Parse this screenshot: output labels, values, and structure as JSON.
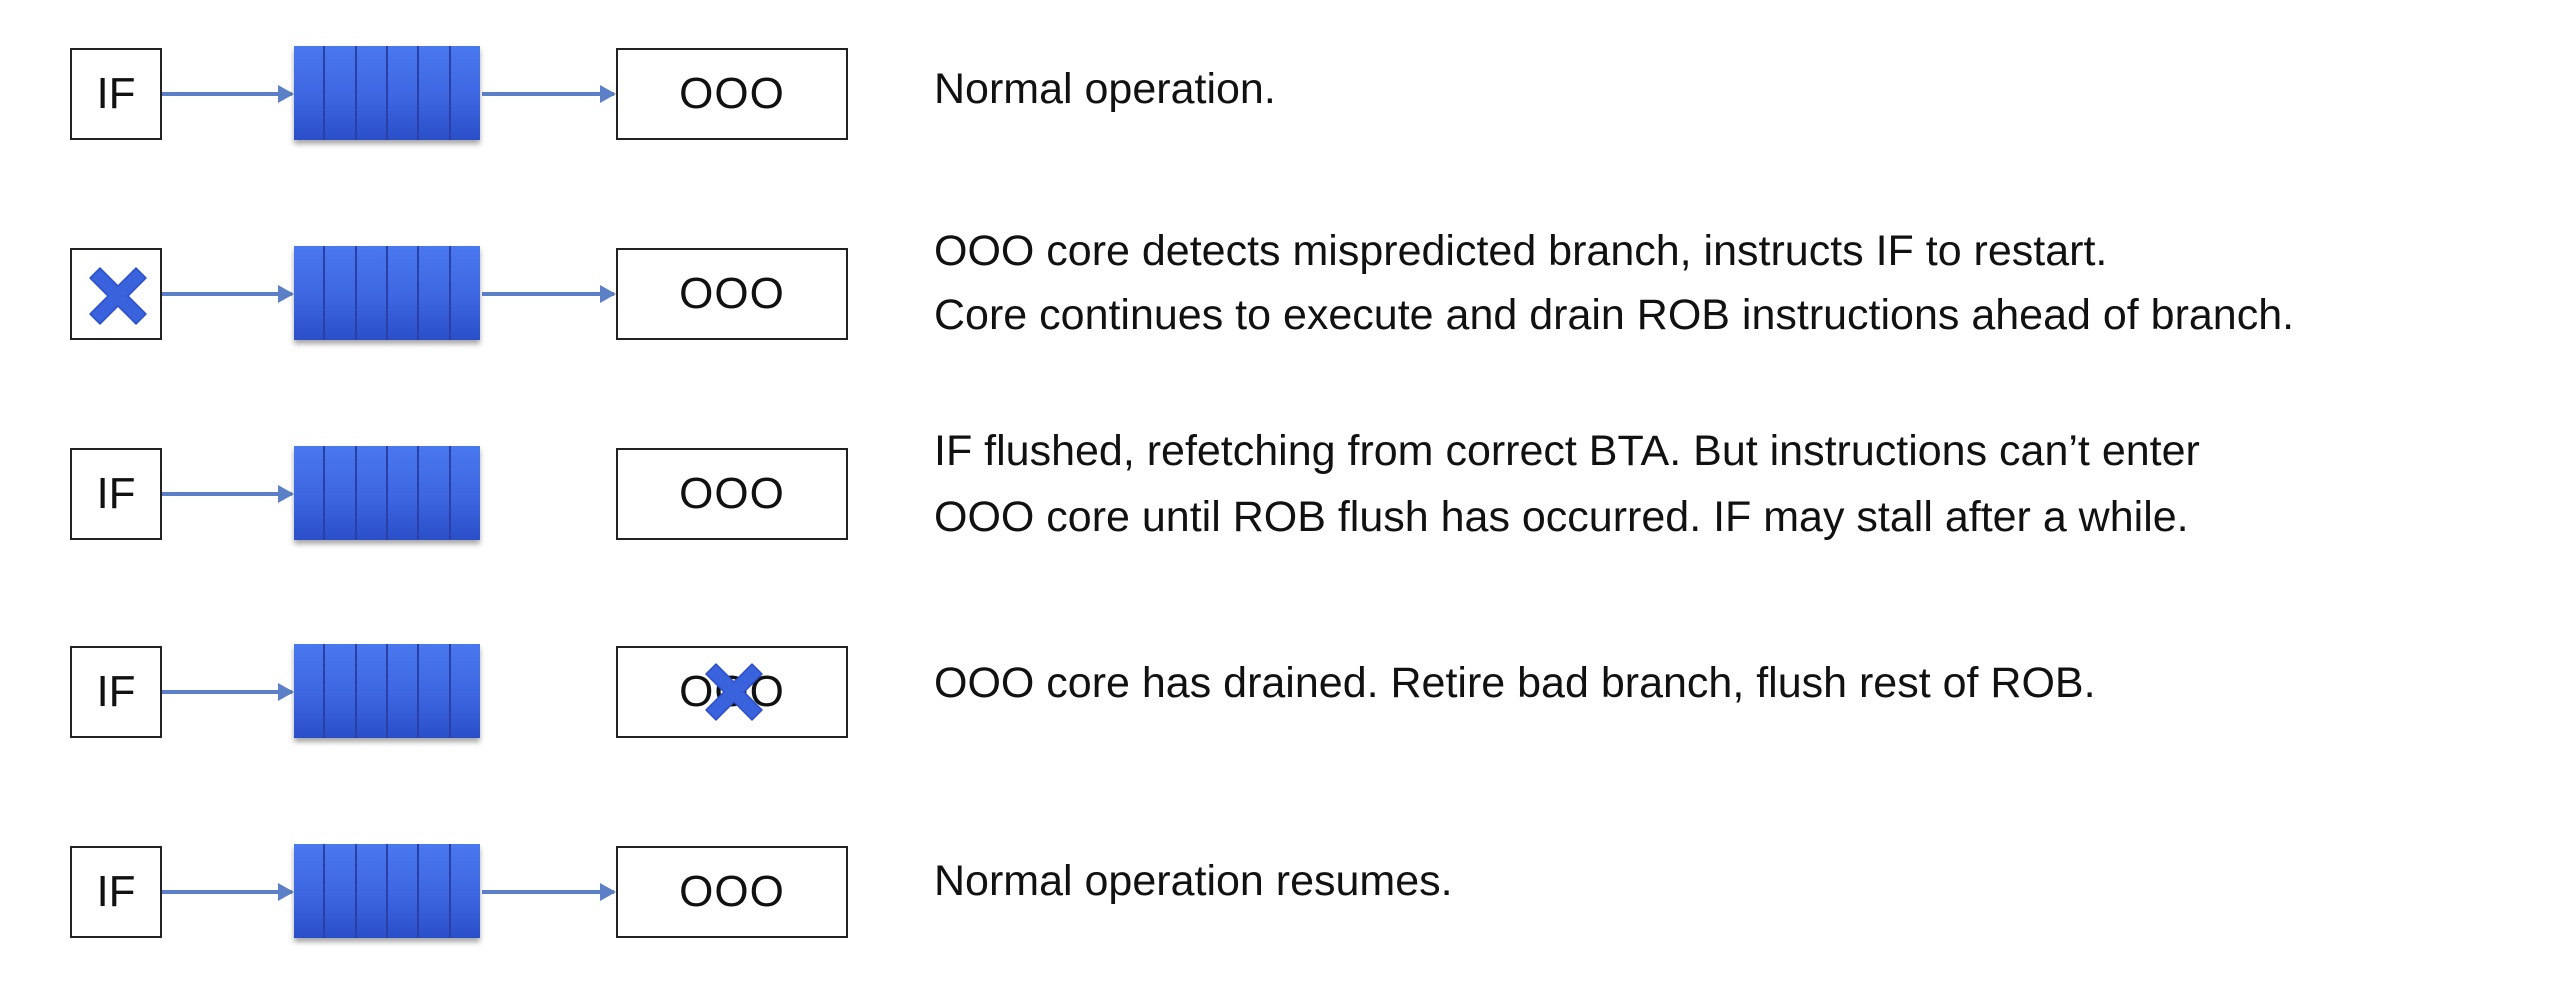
{
  "rows": [
    {
      "if_label": "IF",
      "ooo_label": "OOO",
      "if_crossed": false,
      "ooo_crossed": false,
      "arrow_out": true,
      "description": [
        "Normal operation."
      ]
    },
    {
      "if_label": "",
      "ooo_label": "OOO",
      "if_crossed": true,
      "ooo_crossed": false,
      "arrow_out": true,
      "description": [
        "OOO core detects mispredicted branch, instructs IF to restart.",
        "Core continues to execute and drain ROB instructions ahead of branch."
      ]
    },
    {
      "if_label": "IF",
      "ooo_label": "OOO",
      "if_crossed": false,
      "ooo_crossed": false,
      "arrow_out": false,
      "description": [
        "IF flushed, refetching from correct BTA. But instructions can’t enter",
        "OOO core until ROB flush has occurred. IF may stall after a while."
      ]
    },
    {
      "if_label": "IF",
      "ooo_label": "OOO",
      "if_crossed": false,
      "ooo_crossed": true,
      "arrow_out": false,
      "description": [
        "OOO core has drained. Retire bad branch, flush rest of ROB."
      ]
    },
    {
      "if_label": "IF",
      "ooo_label": "OOO",
      "if_crossed": false,
      "ooo_crossed": false,
      "arrow_out": true,
      "description": [
        "Normal operation resumes."
      ]
    }
  ],
  "colors": {
    "queue": "#3d66e0",
    "arrow": "#5b80c7",
    "cross": "#3a62dc"
  }
}
